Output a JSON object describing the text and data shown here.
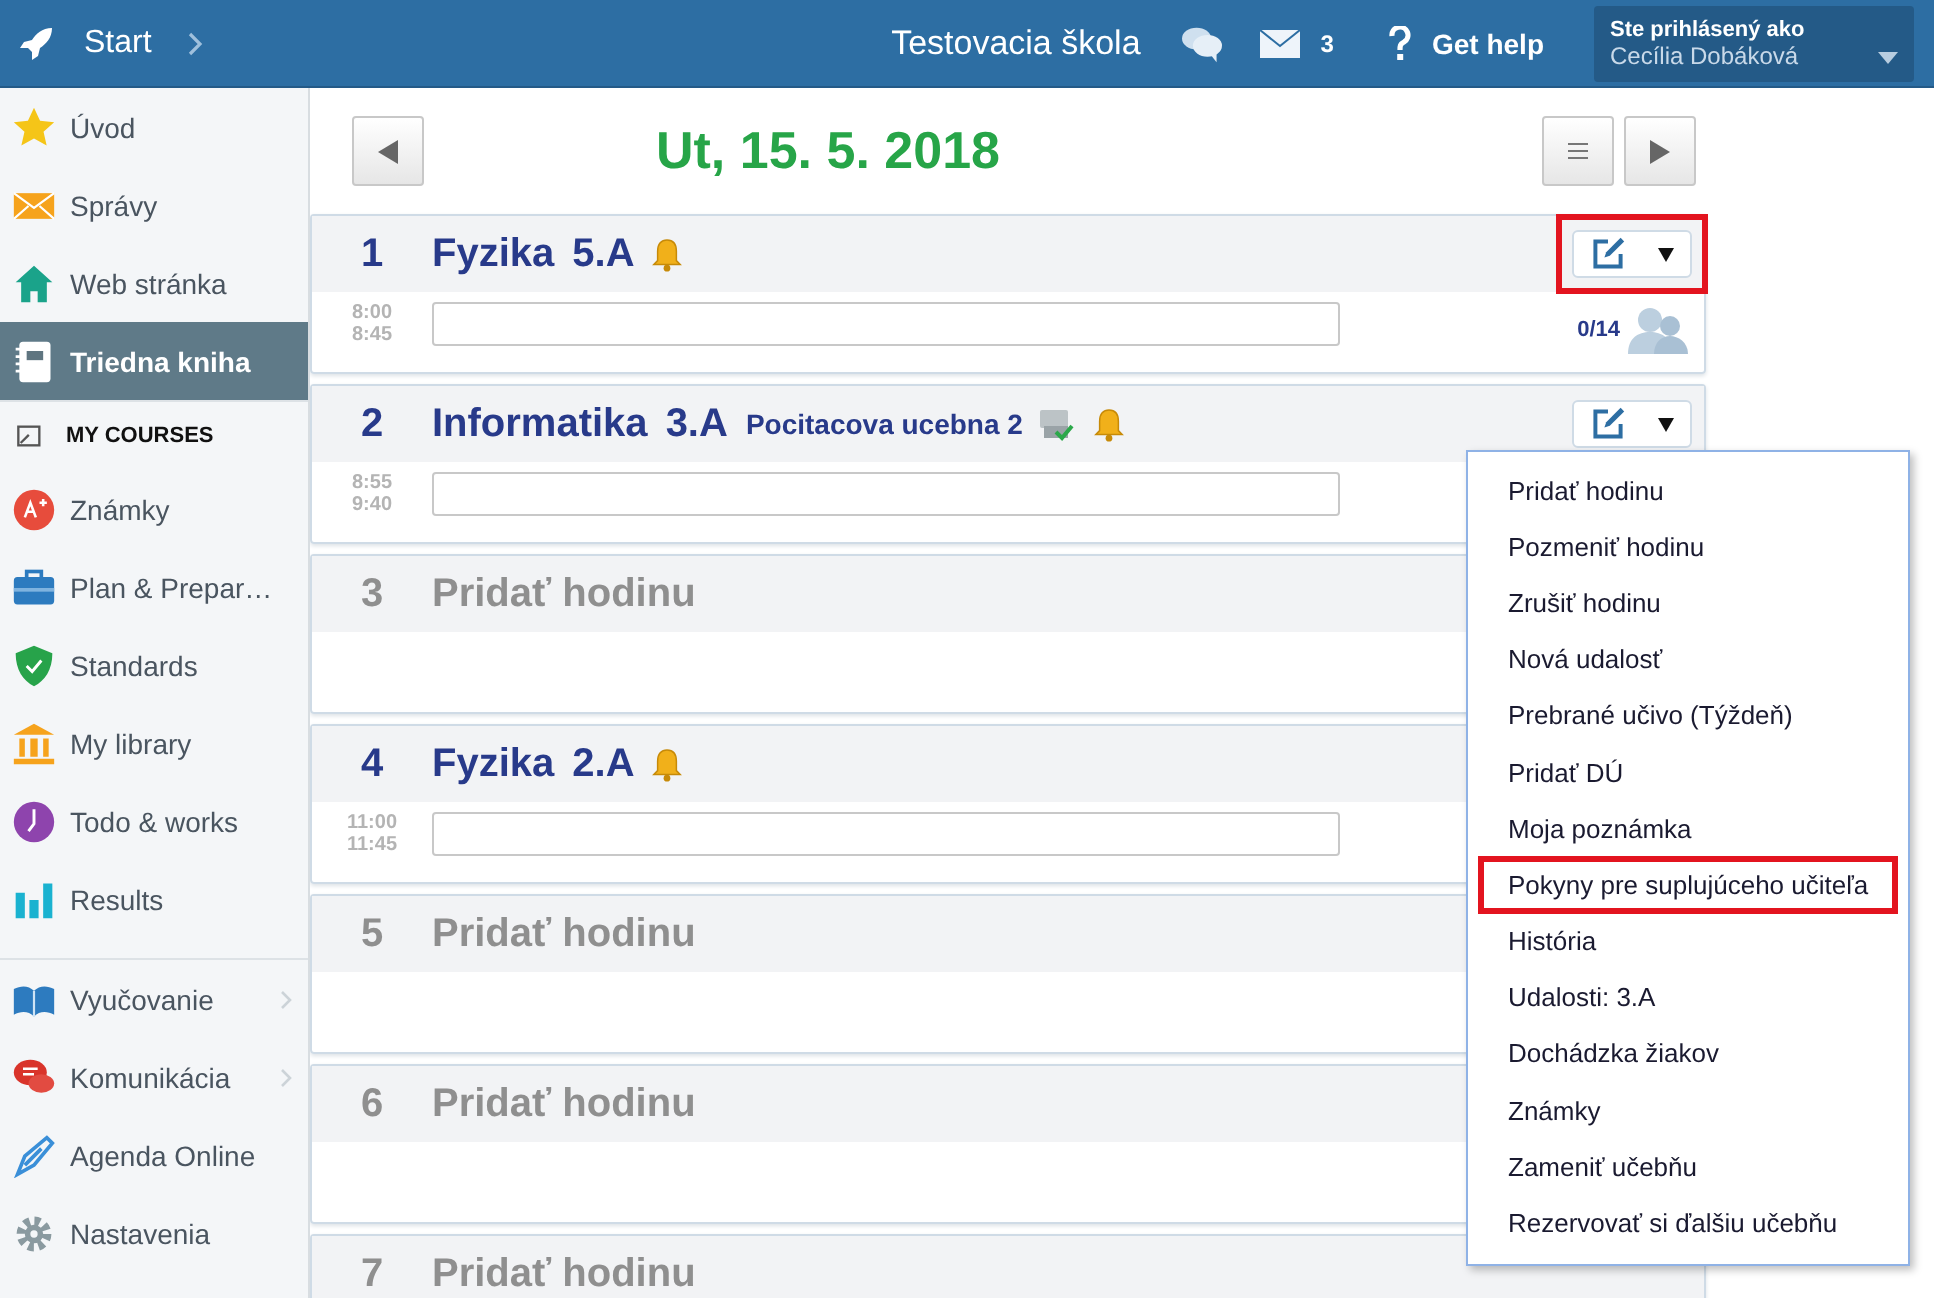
{
  "header": {
    "start": "Start",
    "school": "Testovacia škola",
    "messages_count": "3",
    "help": "Get help",
    "user_caption": "Ste prihlásený ako",
    "user_name": "Cecília Dobáková"
  },
  "sidebar": {
    "items": [
      {
        "label": "Úvod",
        "kind": "link",
        "selected": false
      },
      {
        "label": "Správy",
        "kind": "link",
        "selected": false
      },
      {
        "label": "Web stránka",
        "kind": "link",
        "selected": false
      },
      {
        "label": "Triedna kniha",
        "kind": "link",
        "selected": true
      },
      {
        "label": "MY COURSES",
        "kind": "heading",
        "selected": false
      },
      {
        "label": "Známky",
        "kind": "link",
        "selected": false
      },
      {
        "label": "Plan & Prepar…",
        "kind": "link",
        "selected": false
      },
      {
        "label": "Standards",
        "kind": "link",
        "selected": false
      },
      {
        "label": "My library",
        "kind": "link",
        "selected": false
      },
      {
        "label": "Todo & works",
        "kind": "link",
        "selected": false
      },
      {
        "label": "Results",
        "kind": "link",
        "selected": false
      },
      {
        "label": "Vyučovanie",
        "kind": "submenu",
        "selected": false,
        "separator_before": true
      },
      {
        "label": "Komunikácia",
        "kind": "submenu",
        "selected": false
      },
      {
        "label": "Agenda Online",
        "kind": "link",
        "selected": false
      },
      {
        "label": "Nastavenia",
        "kind": "link",
        "selected": false
      }
    ]
  },
  "date": "Ut, 15. 5. 2018",
  "lessons": [
    {
      "number": "1",
      "kind": "lesson",
      "subject": "Fyzika",
      "class": "5.A",
      "start": "8:00",
      "end": "8:45",
      "attendance": "0/14",
      "action_button": {
        "highlighted": true
      }
    },
    {
      "number": "2",
      "kind": "lesson",
      "subject": "Informatika",
      "class": "3.A",
      "room": "Pocitacova ucebna 2",
      "start": "8:55",
      "end": "9:40",
      "action_button": {
        "highlighted": false
      }
    },
    {
      "number": "3",
      "kind": "empty",
      "title": "Pridať hodinu"
    },
    {
      "number": "4",
      "kind": "lesson",
      "subject": "Fyzika",
      "class": "2.A",
      "start": "11:00",
      "end": "11:45"
    },
    {
      "number": "5",
      "kind": "empty",
      "title": "Pridať hodinu"
    },
    {
      "number": "6",
      "kind": "empty",
      "title": "Pridať hodinu"
    },
    {
      "number": "7",
      "kind": "empty",
      "title": "Pridať hodinu"
    }
  ],
  "menu": {
    "items": [
      {
        "label": "Pridať hodinu",
        "highlighted": false
      },
      {
        "label": "Pozmeniť hodinu",
        "highlighted": false
      },
      {
        "label": "Zrušiť hodinu",
        "highlighted": false
      },
      {
        "label": "Nová udalosť",
        "highlighted": false
      },
      {
        "label": "Prebrané učivo (Týždeň)",
        "highlighted": false
      },
      {
        "label": "Pridať DÚ",
        "highlighted": false
      },
      {
        "label": "Moja poznámka",
        "highlighted": false
      },
      {
        "label": "Pokyny pre suplujúceho učiteľa",
        "highlighted": true
      },
      {
        "label": "História",
        "highlighted": false
      },
      {
        "label": "Udalosti: 3.A",
        "highlighted": false
      },
      {
        "label": "Dochádzka žiakov",
        "highlighted": false
      },
      {
        "label": "Známky",
        "highlighted": false
      },
      {
        "label": "Zameniť učebňu",
        "highlighted": false
      },
      {
        "label": "Rezervovať si ďalšiu učebňu",
        "highlighted": false
      }
    ]
  }
}
